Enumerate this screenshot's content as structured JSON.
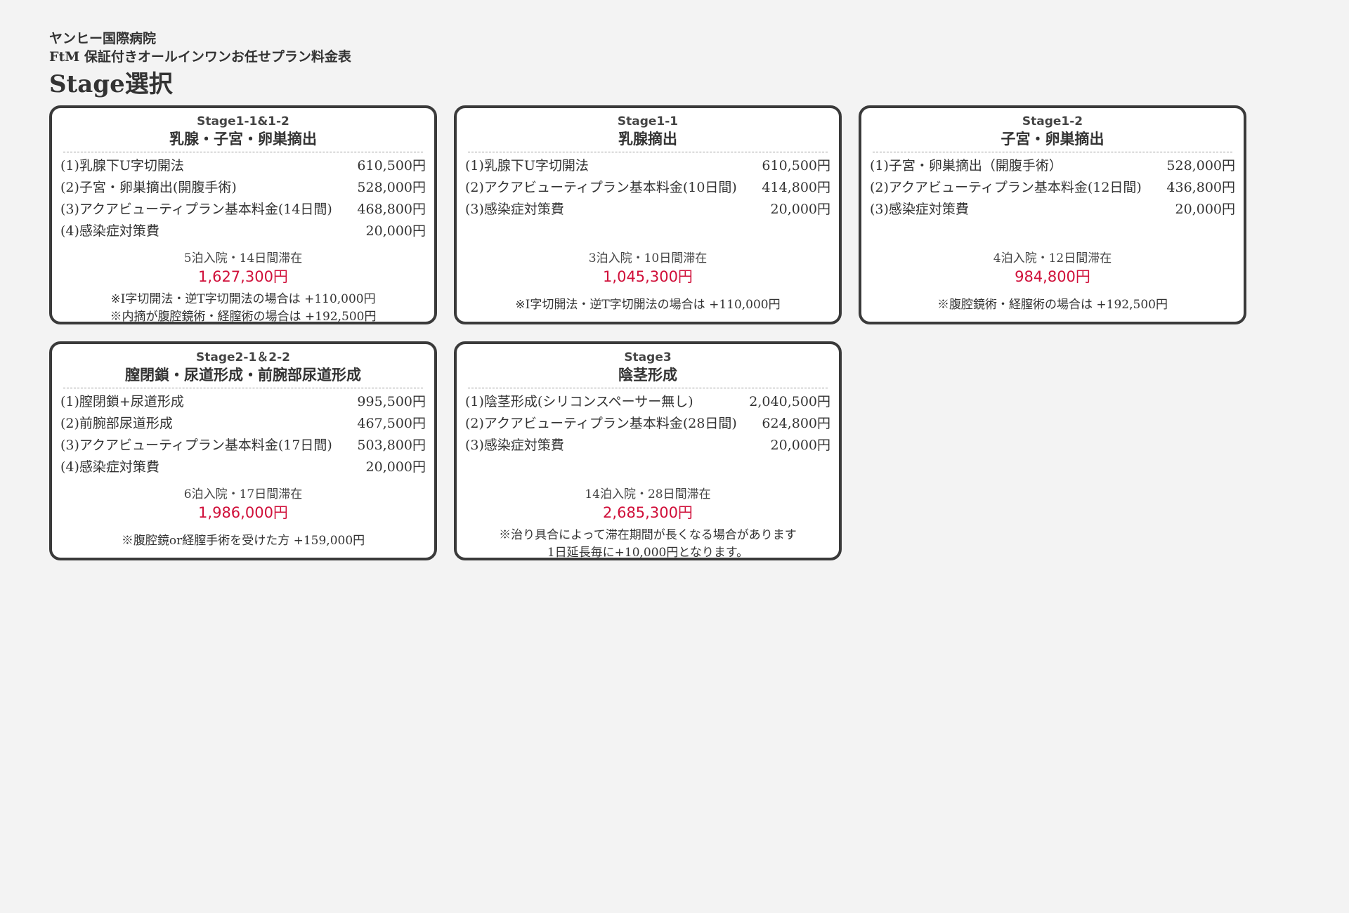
{
  "header": {
    "hospital": "ヤンヒー国際病院",
    "plan_title": "FtM 保証付きオールインワンお任せプラン料金表",
    "section_title": "Stage選択"
  },
  "cards": [
    {
      "stage": "Stage1-1&1-2",
      "name": "乳腺・子宮・卵巣摘出",
      "items": [
        {
          "label": "(1)乳腺下U字切開法",
          "price": "610,500円"
        },
        {
          "label": "(2)子宮・卵巣摘出(開腹手術)",
          "price": "528,000円"
        },
        {
          "label": "(3)アクアビューティプラン基本料金(14日間)",
          "price": "468,800円"
        },
        {
          "label": "(4)感染症対策費",
          "price": "20,000円"
        }
      ],
      "stay": "5泊入院・14日間滞在",
      "total": "1,627,300円",
      "notes": [
        "※I字切開法・逆T字切開法の場合は +110,000円",
        "※内摘が腹腔鏡術・経膣術の場合は +192,500円"
      ]
    },
    {
      "stage": "Stage1-1",
      "name": "乳腺摘出",
      "items": [
        {
          "label": "(1)乳腺下U字切開法",
          "price": "610,500円"
        },
        {
          "label": "(2)アクアビューティプラン基本料金(10日間)",
          "price": "414,800円"
        },
        {
          "label": "(3)感染症対策費",
          "price": "20,000円"
        }
      ],
      "stay": "3泊入院・10日間滞在",
      "total": "1,045,300円",
      "notes": [
        "※I字切開法・逆T字切開法の場合は +110,000円"
      ]
    },
    {
      "stage": "Stage1-2",
      "name": "子宮・卵巣摘出",
      "items": [
        {
          "label": "(1)子宮・卵巣摘出（開腹手術）",
          "price": "528,000円"
        },
        {
          "label": "(2)アクアビューティプラン基本料金(12日間)",
          "price": "436,800円"
        },
        {
          "label": "(3)感染症対策費",
          "price": "20,000円"
        }
      ],
      "stay": "4泊入院・12日間滞在",
      "total": "984,800円",
      "notes": [
        "※腹腔鏡術・経膣術の場合は +192,500円"
      ]
    },
    {
      "stage": "Stage2-1＆2-2",
      "name": "膣閉鎖・尿道形成・前腕部尿道形成",
      "items": [
        {
          "label": "(1)膣閉鎖+尿道形成",
          "price": "995,500円"
        },
        {
          "label": "(2)前腕部尿道形成",
          "price": "467,500円"
        },
        {
          "label": "(3)アクアビューティプラン基本料金(17日間)",
          "price": "503,800円"
        },
        {
          "label": "(4)感染症対策費",
          "price": "20,000円"
        }
      ],
      "stay": "6泊入院・17日間滞在",
      "total": "1,986,000円",
      "notes": [
        "※腹腔鏡or経膣手術を受けた方 +159,000円"
      ]
    },
    {
      "stage": "Stage3",
      "name": "陰茎形成",
      "items": [
        {
          "label": "(1)陰茎形成(シリコンスペーサー無し)",
          "price": "2,040,500円"
        },
        {
          "label": "(2)アクアビューティプラン基本料金(28日間)",
          "price": "624,800円"
        },
        {
          "label": "(3)感染症対策費",
          "price": "20,000円"
        }
      ],
      "stay": "14泊入院・28日間滞在",
      "total": "2,685,300円",
      "notes": [
        "※治り具合によって滞在期間が長くなる場合があります",
        "1日延長毎に+10,000円となります。"
      ]
    }
  ]
}
